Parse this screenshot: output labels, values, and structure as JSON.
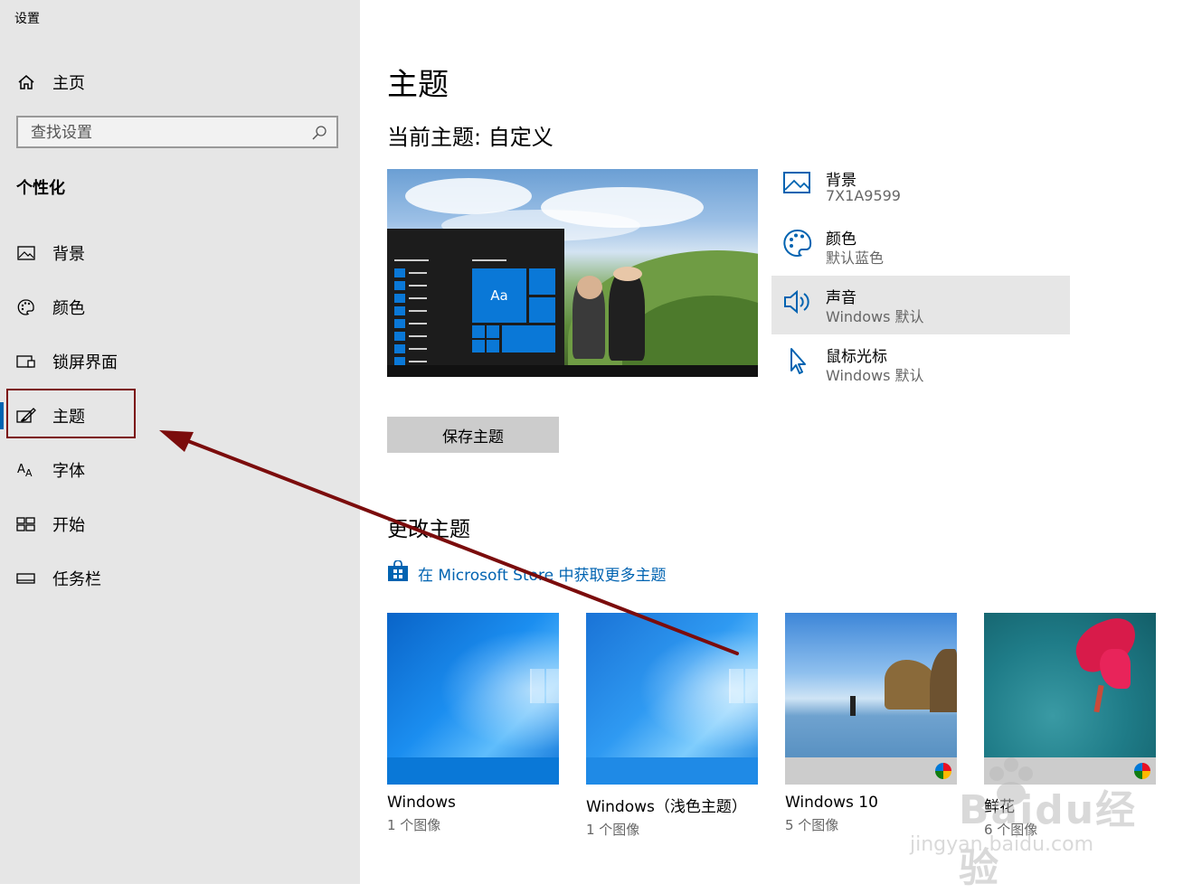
{
  "window": {
    "title": "设置"
  },
  "sidebar": {
    "home_label": "主页",
    "search_placeholder": "查找设置",
    "section_title": "个性化",
    "items": [
      {
        "label": "背景",
        "icon": "image-icon",
        "active": false
      },
      {
        "label": "颜色",
        "icon": "palette-icon",
        "active": false
      },
      {
        "label": "锁屏界面",
        "icon": "lock-screen-icon",
        "active": false
      },
      {
        "label": "主题",
        "icon": "theme-brush-icon",
        "active": true
      },
      {
        "label": "字体",
        "icon": "font-icon",
        "active": false
      },
      {
        "label": "开始",
        "icon": "start-grid-icon",
        "active": false
      },
      {
        "label": "任务栏",
        "icon": "taskbar-icon",
        "active": false
      }
    ]
  },
  "main": {
    "title": "主题",
    "current_theme": "当前主题: 自定义",
    "preview": {
      "tile_label": "Aa"
    },
    "properties": [
      {
        "title": "背景",
        "value": "7X1A9599",
        "icon": "image-icon"
      },
      {
        "title": "颜色",
        "value": "默认蓝色",
        "icon": "palette-icon"
      },
      {
        "title": "声音",
        "value": "Windows 默认",
        "icon": "speaker-icon",
        "selected": true
      },
      {
        "title": "鼠标光标",
        "value": "Windows 默认",
        "icon": "cursor-icon"
      }
    ],
    "save_button": "保存主题",
    "change_title": "更改主题",
    "store_link": "在 Microsoft Store 中获取更多主题",
    "themes": [
      {
        "name": "Windows",
        "count": "1 个图像"
      },
      {
        "name": "Windows（浅色主题）",
        "count": "1 个图像"
      },
      {
        "name": "Windows 10",
        "count": "5 个图像"
      },
      {
        "name": "鲜花",
        "count": "6 个图像"
      }
    ]
  },
  "colors": {
    "accent": "#0063b1",
    "annotation": "#7b0c0c",
    "sidebar_bg": "#e6e6e6"
  },
  "watermark": {
    "brand": "Baidu经验",
    "url": "jingyan.baidu.com"
  }
}
